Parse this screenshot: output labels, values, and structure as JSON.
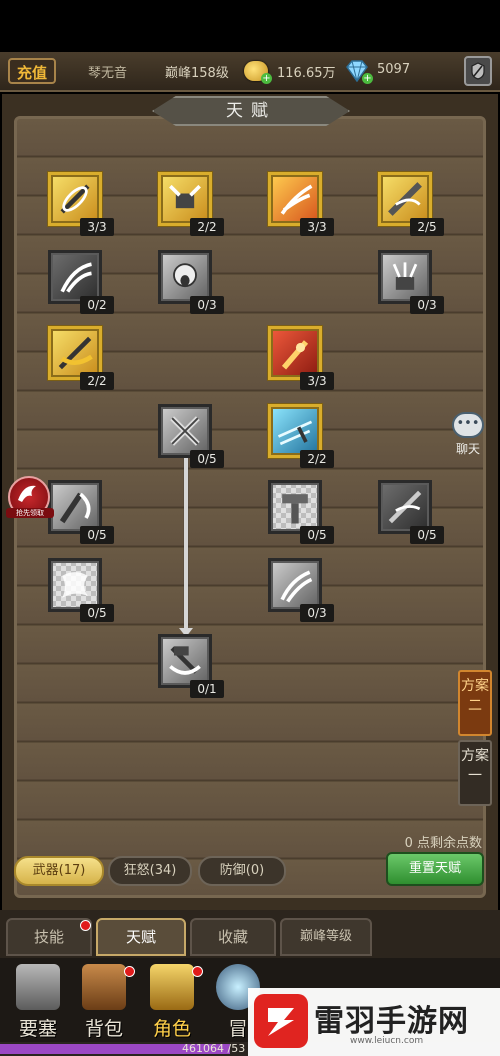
{
  "header": {
    "recharge_label": "充值",
    "player_name": "琴无音",
    "level": "巅峰158级",
    "gold": "116.65万",
    "gems": "5097"
  },
  "panel": {
    "title": "天赋",
    "points_remaining": "0 点剩余点数",
    "chat_label": "聊天",
    "side_badge": "抢先领取",
    "plans": [
      {
        "label": "方案二",
        "active": true
      },
      {
        "label": "方案一",
        "active": false
      }
    ]
  },
  "talents": [
    {
      "id": "w1",
      "count": "3/3",
      "style": "gold y"
    },
    {
      "id": "w2",
      "count": "2/2",
      "style": "gold y"
    },
    {
      "id": "w3",
      "count": "3/3",
      "style": "gold o"
    },
    {
      "id": "w4",
      "count": "2/5",
      "style": "gold y"
    },
    {
      "id": "w5",
      "count": "0/2",
      "style": "dark"
    },
    {
      "id": "w6",
      "count": "0/3",
      "style": "grey"
    },
    {
      "id": "w7",
      "count": "0/3",
      "style": "grey"
    },
    {
      "id": "w8",
      "count": "2/2",
      "style": "gold y"
    },
    {
      "id": "w9",
      "count": "3/3",
      "style": "gold r"
    },
    {
      "id": "w10",
      "count": "0/5",
      "style": "grey"
    },
    {
      "id": "w11",
      "count": "2/2",
      "style": "gold b"
    },
    {
      "id": "w12",
      "count": "0/5",
      "style": "grey"
    },
    {
      "id": "w13",
      "count": "0/5",
      "style": "checker"
    },
    {
      "id": "w14",
      "count": "0/5",
      "style": "dark"
    },
    {
      "id": "w15",
      "count": "0/5",
      "style": "checker"
    },
    {
      "id": "w16",
      "count": "0/3",
      "style": "grey"
    },
    {
      "id": "w17",
      "count": "0/1",
      "style": "grey"
    }
  ],
  "categories": [
    {
      "label": "武器(17)",
      "active": true
    },
    {
      "label": "狂怒(34)",
      "active": false
    },
    {
      "label": "防御(0)",
      "active": false
    }
  ],
  "reset_label": "重置天赋",
  "subnav": [
    {
      "label": "技能",
      "active": false,
      "dot": true
    },
    {
      "label": "天赋",
      "active": true,
      "dot": false
    },
    {
      "label": "收藏",
      "active": false,
      "dot": false
    },
    {
      "label": "巅峰等级",
      "active": false,
      "dot": false
    }
  ],
  "bottomnav": [
    {
      "label": "要塞",
      "active": false,
      "icon": "fortress-icon"
    },
    {
      "label": "背包",
      "active": false,
      "icon": "backpack-icon"
    },
    {
      "label": "角色",
      "active": true,
      "icon": "helmet-icon"
    },
    {
      "label": "冒",
      "active": false,
      "icon": "portal-icon"
    }
  ],
  "exp_text": "461064 /53",
  "exp_fraction": 0.46,
  "watermark": {
    "name": "雷羽手游网",
    "url": "www.leiucn.com"
  },
  "colors": {
    "gold": "#d9ad2c",
    "reset_green": "#2f8f2f",
    "plan_active": "#7b3a10",
    "exp_purple": "#9b48c4"
  }
}
